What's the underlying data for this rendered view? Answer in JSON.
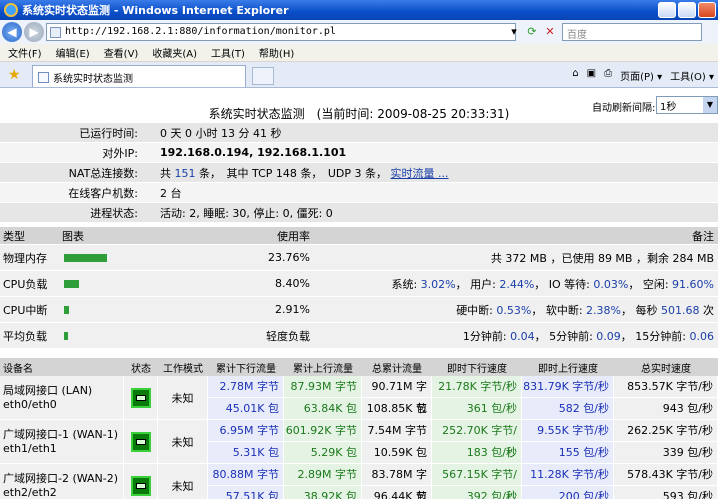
{
  "window": {
    "title": "系统实时状态监测 - Windows Internet Explorer"
  },
  "browser": {
    "address": "http://192.168.2.1:880/information/monitor.pl",
    "search_placeholder": "百度",
    "menu": [
      "文件(F)",
      "编辑(E)",
      "查看(V)",
      "收藏夹(A)",
      "工具(T)",
      "帮助(H)"
    ],
    "tab_title": "系统实时状态监测",
    "page_menu": "页面(P) ▾",
    "tools_menu": "工具(O) ▾"
  },
  "page": {
    "heading": "系统实时状态监测　(当前时间: 2009-08-25 20:33:31)",
    "refresh_label": "自动刷新间隔:",
    "refresh_value": "1秒"
  },
  "info": {
    "uptime_label": "已运行时间:",
    "uptime_value": "0 天 0 小时 13 分 41 秒",
    "ip_label": "对外IP:",
    "ip_value": "192.168.0.194, 192.168.1.101",
    "nat_label": "NAT总连接数:",
    "nat_total_prefix": "共",
    "nat_total": "151",
    "nat_mid": "条，　其中 TCP 148 条，　UDP 3 条，",
    "nat_link": "实时流量 ...",
    "clients_label": "在线客户机数:",
    "clients_value": "2 台",
    "process_label": "进程状态:",
    "process_value": "活动: 2, 睡眠: 30, 停止: 0, 僵死: 0"
  },
  "resources": {
    "headers": {
      "type": "类型",
      "chart": "图表",
      "usage": "使用率",
      "note": "备注"
    },
    "rows": [
      {
        "type": "物理内存",
        "level": 0.2376,
        "usage": "23.76%",
        "note_parts": [
          [
            "共 372 MB ，已使用 89 MB ，剩余 284 MB",
            ""
          ]
        ]
      },
      {
        "type": "CPU负载",
        "level": 0.084,
        "usage": "8.40%",
        "note_parts": [
          [
            "系统: ",
            ""
          ],
          [
            "3.02%",
            "blue"
          ],
          [
            "， 用户: ",
            ""
          ],
          [
            "2.44%",
            "blue"
          ],
          [
            "， IO 等待: ",
            ""
          ],
          [
            "0.03%",
            "blue"
          ],
          [
            "， 空闲: ",
            ""
          ],
          [
            "91.60%",
            "blue"
          ]
        ]
      },
      {
        "type": "CPU中断",
        "level": 0.0291,
        "usage": "2.91%",
        "note_parts": [
          [
            "硬中断: ",
            ""
          ],
          [
            "0.53%",
            "blue"
          ],
          [
            "， 软中断: ",
            ""
          ],
          [
            "2.38%",
            "blue"
          ],
          [
            "， 每秒 ",
            ""
          ],
          [
            "501.68",
            "blue"
          ],
          [
            " 次",
            ""
          ]
        ]
      },
      {
        "type": "平均负载",
        "level": 0.02,
        "usage": "轻度负载",
        "note_parts": [
          [
            "1分钟前: ",
            ""
          ],
          [
            "0.04",
            "blue"
          ],
          [
            "， 5分钟前: ",
            ""
          ],
          [
            "0.09",
            "blue"
          ],
          [
            "， 15分钟前: ",
            ""
          ],
          [
            "0.06",
            "blue"
          ]
        ]
      }
    ]
  },
  "interfaces": {
    "headers": [
      "设备名",
      "状态",
      "工作模式",
      "累计下行流量",
      "累计上行流量",
      "总累计流量",
      "即时下行速度",
      "即时上行速度",
      "总实时速度"
    ],
    "rows": [
      {
        "name1": "局域网接口 (LAN)",
        "name2": "eth0/eth0",
        "mode": "未知",
        "down_total": [
          "2.78M 字节",
          "45.01K 包"
        ],
        "up_total": [
          "87.93M 字节",
          "63.84K 包"
        ],
        "total": [
          "90.71M 字节",
          "108.85K 包"
        ],
        "down_speed": [
          "21.78K 字节/秒",
          "361 包/秒"
        ],
        "up_speed": [
          "831.79K 字节/秒",
          "582 包/秒"
        ],
        "total_speed": [
          "853.57K 字节/秒",
          "943 包/秒"
        ]
      },
      {
        "name1": "广域网接口-1 (WAN-1)",
        "name2": "eth1/eth1",
        "mode": "未知",
        "down_total": [
          "6.95M 字节",
          "5.31K 包"
        ],
        "up_total": [
          "601.92K 字节",
          "5.29K 包"
        ],
        "total": [
          "7.54M 字节",
          "10.59K 包"
        ],
        "down_speed": [
          "252.70K 字节/秒",
          "183 包/秒"
        ],
        "up_speed": [
          "9.55K 字节/秒",
          "155 包/秒"
        ],
        "total_speed": [
          "262.25K 字节/秒",
          "339 包/秒"
        ]
      },
      {
        "name1": "广域网接口-2 (WAN-2)",
        "name2": "eth2/eth2",
        "mode": "未知",
        "down_total": [
          "80.88M 字节",
          "57.51K 包"
        ],
        "up_total": [
          "2.89M 字节",
          "38.92K 包"
        ],
        "total": [
          "83.78M 字节",
          "96.44K 包"
        ],
        "down_speed": [
          "567.15K 字节/秒",
          "392 包/秒"
        ],
        "up_speed": [
          "11.28K 字节/秒",
          "200 包/秒"
        ],
        "total_speed": [
          "578.43K 字节/秒",
          "593 包/秒"
        ]
      }
    ]
  }
}
